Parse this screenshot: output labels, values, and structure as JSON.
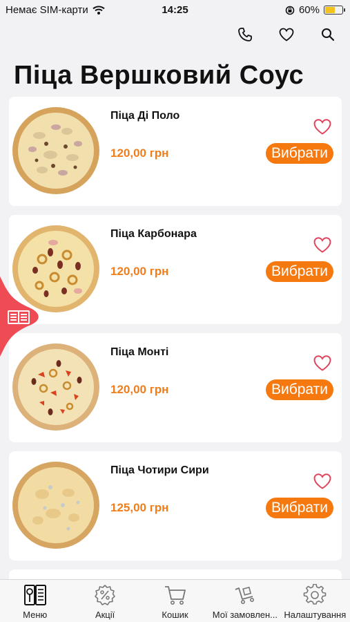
{
  "status": {
    "carrier": "Немає SIM-карти",
    "time": "14:25",
    "battery": "60%",
    "battery_level": 0.6
  },
  "header": {
    "title": "Піца Вершковий Соус",
    "icons": [
      "phone-icon",
      "heart-icon",
      "search-icon"
    ]
  },
  "products": [
    {
      "name": "Піца Ді Поло",
      "price": "120,00 грн",
      "button": "Вибрати"
    },
    {
      "name": "Піца Карбонара",
      "price": "120,00 грн",
      "button": "Вибрати"
    },
    {
      "name": "Піца Монті",
      "price": "120,00 грн",
      "button": "Вибрати"
    },
    {
      "name": "Піца Чотири Сири",
      "price": "125,00 грн",
      "button": "Вибрати"
    }
  ],
  "tabs": [
    {
      "label": "Меню",
      "icon": "menu-book-icon"
    },
    {
      "label": "Акції",
      "icon": "discount-gear-icon"
    },
    {
      "label": "Кошик",
      "icon": "cart-icon"
    },
    {
      "label": "Мої замовлен...",
      "icon": "order-cart-icon"
    },
    {
      "label": "Налаштування",
      "icon": "settings-gear-icon"
    }
  ],
  "colors": {
    "accent": "#f5790f",
    "price": "#f07d1a",
    "heart": "#e0455e",
    "side_tab": "#ef4b55"
  }
}
